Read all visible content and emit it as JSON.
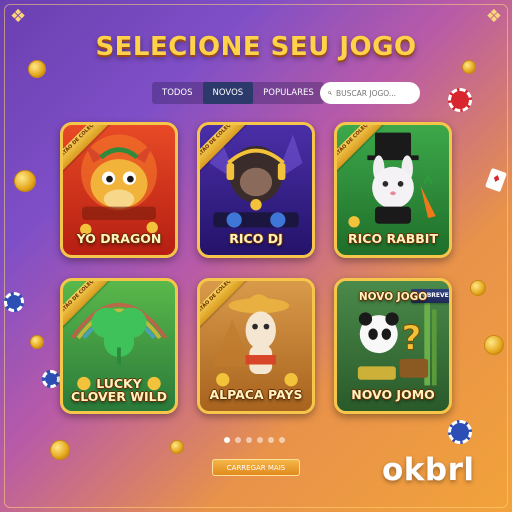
{
  "header": {
    "title": "SELECIONE SEU JOGO"
  },
  "filters": {
    "tabs": [
      {
        "label": "TODOS"
      },
      {
        "label": "NOVOS"
      },
      {
        "label": "POPULARES"
      }
    ],
    "active": "NOVOS"
  },
  "search": {
    "placeholder": "BUSCAR JOGO..."
  },
  "games": [
    {
      "title": "YO DRAGON",
      "ribbon": "CARTÃO DE COLEÇÃO"
    },
    {
      "title": "RICO DJ",
      "ribbon": "CARTÃO DE COLEÇÃO"
    },
    {
      "title": "RICO RABBIT",
      "ribbon": "CARTÃO DE COLEÇÃO"
    },
    {
      "title_line1": "LUCKY",
      "title_line2": "CLOVER WILD",
      "ribbon": "CARTÃO DE COLEÇÃO"
    },
    {
      "title": "ALPACA PAYS",
      "ribbon": "CARTÃO DE COLEÇÃO"
    },
    {
      "top_label": "NOVO JOGO",
      "title": "NOVO JOMO",
      "ribbon": "EM BREVE!"
    }
  ],
  "pagination": {
    "pages": 6,
    "active_page": 1
  },
  "actions": {
    "load_more": "CARREGAR MAIS"
  },
  "brand": {
    "logo": "okbrl"
  },
  "colors": {
    "title": "#ffd24a",
    "card_border": "#f5c64a",
    "active_tab": "#2c3a6b",
    "button": "#f0a030"
  }
}
